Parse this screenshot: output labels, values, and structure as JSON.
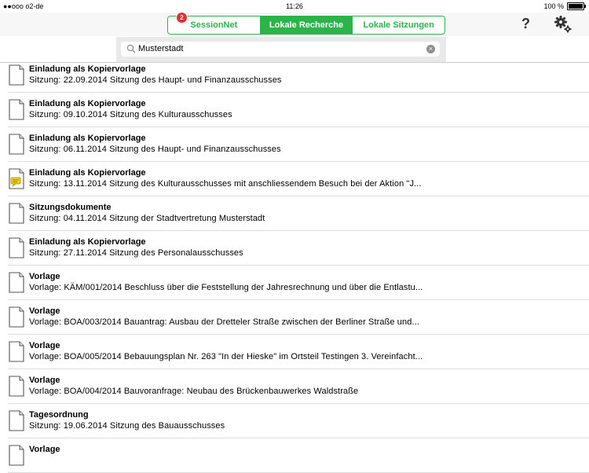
{
  "status": {
    "carrier": "●●ooo o2-de",
    "time": "11:26",
    "battery": "100 %",
    "battery_level": 1.0
  },
  "tabs": [
    {
      "label": "SessionNet",
      "badge": "2",
      "active": false
    },
    {
      "label": "Lokale Recherche",
      "active": true
    },
    {
      "label": "Lokale Sitzungen",
      "active": false
    }
  ],
  "help_label": "?",
  "search": {
    "value": "Musterstadt",
    "clear": "×"
  },
  "items": [
    {
      "title": "Einladung als Kopiervorlage",
      "sub": "Sitzung:  22.09.2014  Sitzung des Haupt- und Finanzausschusses",
      "icon": "document-icon"
    },
    {
      "title": "Einladung als Kopiervorlage",
      "sub": "Sitzung:  09.10.2014  Sitzung des Kulturausschusses",
      "icon": "document-icon"
    },
    {
      "title": "Einladung als Kopiervorlage",
      "sub": "Sitzung:  06.11.2014  Sitzung des Haupt- und Finanzausschusses",
      "icon": "document-icon"
    },
    {
      "title": "Einladung als Kopiervorlage",
      "sub": "Sitzung:  13.11.2014  Sitzung des Kulturausschusses mit anschliessendem Besuch bei der Aktion \"J...",
      "icon": "document-note-icon"
    },
    {
      "title": "Sitzungsdokumente",
      "sub": "Sitzung:  04.11.2014  Sitzung der Stadtvertretung Musterstadt",
      "icon": "document-icon"
    },
    {
      "title": "Einladung als Kopiervorlage",
      "sub": "Sitzung:  27.11.2014  Sitzung des Personalausschusses",
      "icon": "document-icon"
    },
    {
      "title": "Vorlage",
      "sub": "Vorlage: KÄM/001/2014  Beschluss über die Feststellung der Jahresrechnung und über die Entlastu...",
      "icon": "document-icon"
    },
    {
      "title": "Vorlage",
      "sub": "Vorlage: BOA/003/2014  Bauantrag: Ausbau der Dretteler Straße zwischen der Berliner Straße und...",
      "icon": "document-icon"
    },
    {
      "title": "Vorlage",
      "sub": "Vorlage: BOA/005/2014  Bebauungsplan Nr. 263 \"In der Hieske\" im Ortsteil Testingen 3. Vereinfacht...",
      "icon": "document-icon"
    },
    {
      "title": "Vorlage",
      "sub": "Vorlage: BOA/004/2014  Bauvoranfrage: Neubau des Brückenbauwerkes Waldstraße",
      "icon": "document-icon"
    },
    {
      "title": "Tagesordnung",
      "sub": "Sitzung:  19.06.2014  Sitzung des Bauausschusses",
      "icon": "document-icon"
    },
    {
      "title": "Vorlage",
      "sub": "",
      "icon": "document-icon"
    }
  ]
}
